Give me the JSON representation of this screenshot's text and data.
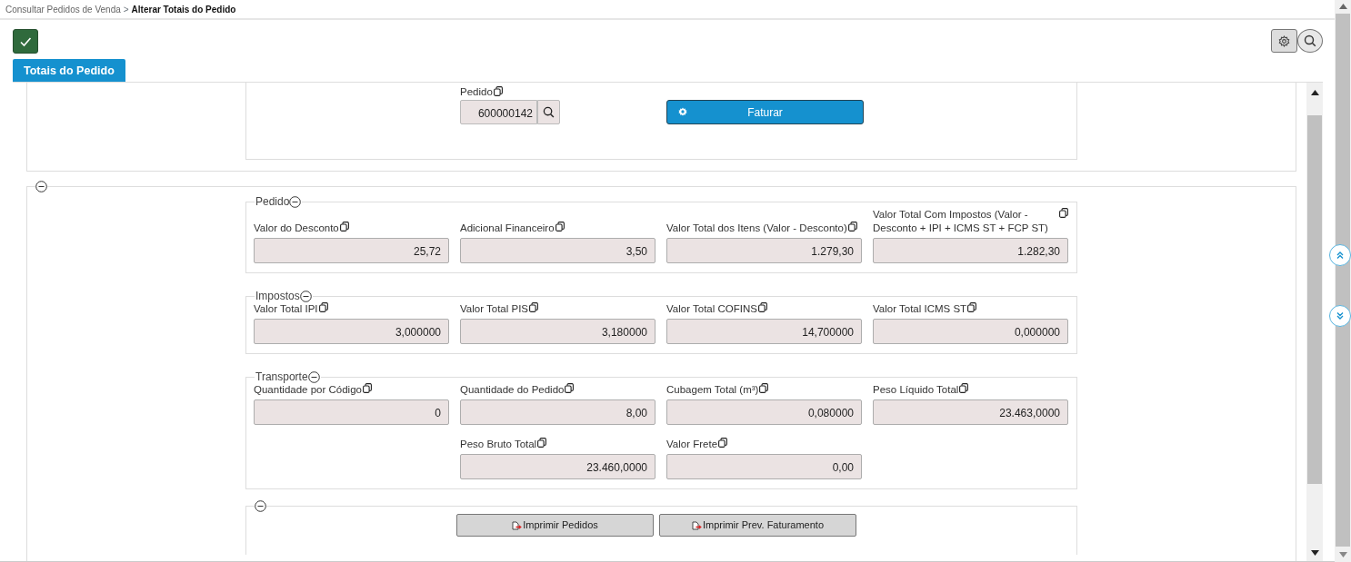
{
  "breadcrumb": [
    {
      "label": "Consultar Pedidos de Venda",
      "current": false
    },
    {
      "label": "Alterar Totais do Pedido",
      "current": true
    }
  ],
  "separator": ">",
  "tabs": [
    {
      "label": "Totais do Pedido",
      "selected": true
    }
  ],
  "header_panel": {
    "pedido": {
      "label": "Pedido",
      "value": "600000142"
    },
    "faturar_button": {
      "label": "Faturar"
    }
  },
  "main_panel": {
    "expanded": true
  },
  "sections": [
    {
      "title": "Pedido",
      "expanded": true,
      "rows": [
        [
          {
            "label": "Valor do Desconto",
            "value": "25,72"
          },
          {
            "label": "Adicional Financeiro",
            "value": "3,50"
          },
          {
            "label": "Valor Total dos Itens (Valor - Desconto)",
            "value": "1.279,30"
          },
          {
            "label": "Valor Total Com Impostos (Valor - Desconto + IPI + ICMS ST + FCP ST)",
            "value": "1.282,30"
          }
        ]
      ]
    },
    {
      "title": "Impostos",
      "expanded": true,
      "rows": [
        [
          {
            "label": "Valor Total IPI",
            "value": "3,000000"
          },
          {
            "label": "Valor Total PIS",
            "value": "3,180000"
          },
          {
            "label": "Valor Total COFINS",
            "value": "14,700000"
          },
          {
            "label": "Valor Total ICMS ST",
            "value": "0,000000"
          }
        ]
      ]
    },
    {
      "title": "Transporte",
      "expanded": true,
      "rows": [
        [
          {
            "label": "Quantidade por Código",
            "value": "0"
          },
          {
            "label": "Quantidade do Pedido",
            "value": "8,00"
          },
          {
            "label": "Cubagem Total (m³)",
            "value": "0,080000"
          },
          {
            "label": "Peso Líquido Total",
            "value": "23.463,0000"
          }
        ],
        [
          "",
          {
            "label": "Peso Bruto Total",
            "value": "23.460,0000"
          },
          {
            "label": "Valor Frete",
            "value": "0,00"
          }
        ]
      ]
    }
  ],
  "actions_panel": {
    "expanded": true,
    "buttons": [
      {
        "label": "Imprimir Pedidos"
      },
      {
        "label": "Imprimir Prev. Faturamento"
      }
    ]
  }
}
